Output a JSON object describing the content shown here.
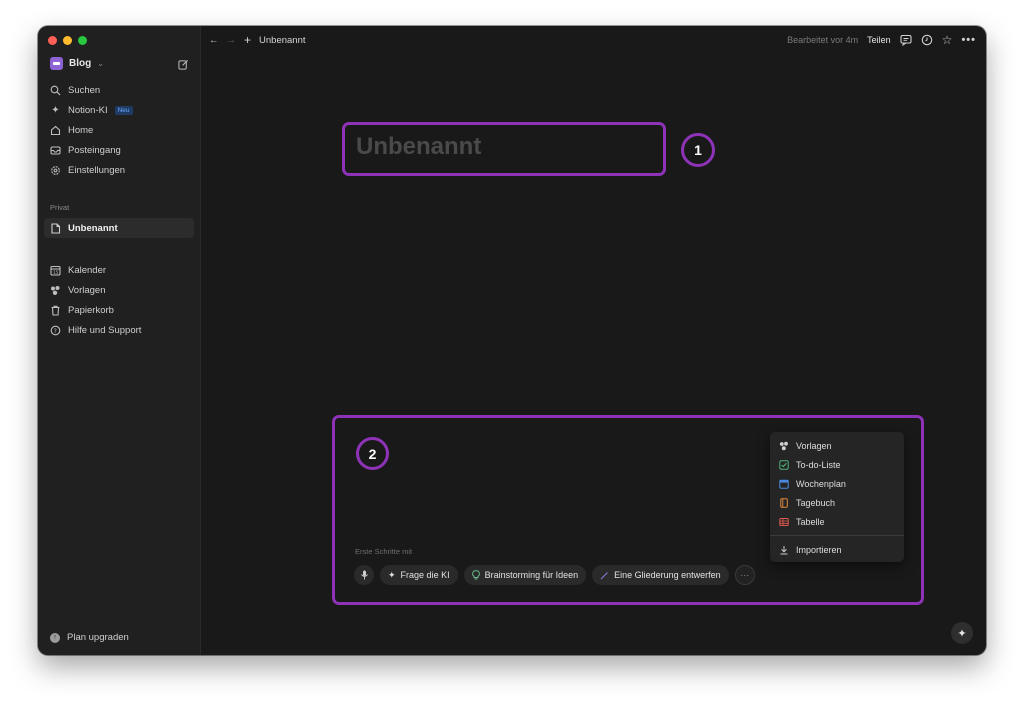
{
  "sidebar": {
    "workspace": "Blog",
    "nav": [
      {
        "label": "Suchen",
        "icon": "search-icon"
      },
      {
        "label": "Notion-KI",
        "icon": "sparkle-icon",
        "badge": "Neu"
      },
      {
        "label": "Home",
        "icon": "home-icon"
      },
      {
        "label": "Posteingang",
        "icon": "inbox-icon"
      },
      {
        "label": "Einstellungen",
        "icon": "gear-icon"
      }
    ],
    "private_label": "Privat",
    "private_items": [
      {
        "label": "Unbenannt",
        "icon": "page-icon"
      }
    ],
    "bottom_items": [
      {
        "label": "Kalender",
        "icon": "calendar-icon"
      },
      {
        "label": "Vorlagen",
        "icon": "templates-icon"
      },
      {
        "label": "Papierkorb",
        "icon": "trash-icon"
      },
      {
        "label": "Hilfe und Support",
        "icon": "help-icon"
      }
    ],
    "plan_upgrade": "Plan upgraden"
  },
  "topbar": {
    "breadcrumb": "Unbenannt",
    "edited": "Bearbeitet vor 4m",
    "share": "Teilen"
  },
  "page": {
    "title_placeholder": "Unbenannt",
    "start_label": "Erste Schritte mit",
    "chips": [
      {
        "label": "Frage die KI",
        "icon": "sparkle-icon"
      },
      {
        "label": "Brainstorming für Ideen",
        "icon": "lightbulb-icon"
      },
      {
        "label": "Eine Gliederung entwerfen",
        "icon": "pen-icon"
      }
    ]
  },
  "menu": {
    "items": [
      {
        "label": "Vorlagen",
        "icon": "templates-icon"
      },
      {
        "label": "To-do-Liste",
        "icon": "checkbox-icon"
      },
      {
        "label": "Wochenplan",
        "icon": "calendar-icon"
      },
      {
        "label": "Tagebuch",
        "icon": "book-icon"
      },
      {
        "label": "Tabelle",
        "icon": "table-icon"
      }
    ],
    "import": "Importieren"
  },
  "annotations": {
    "one": "1",
    "two": "2"
  },
  "colors": {
    "accent": "#8e33b8",
    "bg": "#191919",
    "sidebar": "#202020"
  }
}
